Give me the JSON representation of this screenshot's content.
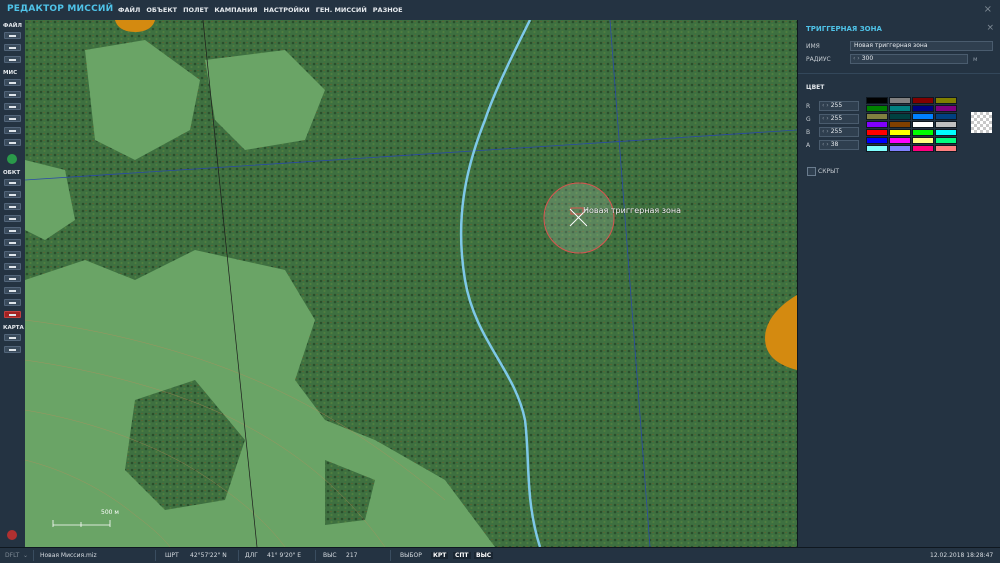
{
  "app": {
    "title": "РЕДАКТОР МИССИЙ",
    "close_glyph": "×"
  },
  "menu": [
    "ФАЙЛ",
    "ОБЪЕКТ",
    "ПОЛЕТ",
    "КАМПАНИЯ",
    "НАСТРОЙКИ",
    "ГЕН. МИССИЙ",
    "РАЗНОЕ"
  ],
  "toolbar": {
    "file": "ФАЙЛ",
    "mission": "МИС",
    "objects": "ОБКТ",
    "map": "КАРТА"
  },
  "map": {
    "zone_label": "Новая триггерная зона",
    "scale_label": "500 м"
  },
  "panel": {
    "title": "ТРИГГЕРНАЯ ЗОНА",
    "close_glyph": "×",
    "name_label": "ИМЯ",
    "name_value": "Новая триггерная зона",
    "radius_label": "РАДИУС",
    "radius_value": "300",
    "radius_unit": "м",
    "color_title": "ЦВЕТ",
    "r_label": "R",
    "r_value": "255",
    "g_label": "G",
    "g_value": "255",
    "b_label": "B",
    "b_value": "255",
    "a_label": "A",
    "a_value": "38",
    "hidden_label": "СКРЫТ",
    "palette": [
      "#000000",
      "#808080",
      "#800000",
      "#808000",
      "#008000",
      "#008080",
      "#000080",
      "#800080",
      "#808040",
      "#004040",
      "#0080ff",
      "#004080",
      "#8000ff",
      "#804000",
      "#ffffff",
      "#c0c0c0",
      "#ff0000",
      "#ffff00",
      "#00ff00",
      "#00ffff",
      "#0000ff",
      "#ff00ff",
      "#ffff80",
      "#00ff80",
      "#80ffff",
      "#8080ff",
      "#ff0080",
      "#ff8080"
    ]
  },
  "status": {
    "profile": "DFLT",
    "file": "Новая Миссия.miz",
    "lat_label": "ШРТ",
    "lat_value": "42°57'22\" N",
    "lon_label": "ДЛГ",
    "lon_value": "41° 9'20\" E",
    "alt_label": "ВЫС",
    "alt_value": "217",
    "select_label": "ВЫБОР",
    "btn_map": "КРТ",
    "btn_sat": "СПТ",
    "btn_alt": "ВЫС",
    "datetime": "12.02.2018 18:28:47"
  },
  "colors": {
    "accent": "#4fc3e8",
    "zone": "#d9534f",
    "map_green": "#5f9a5e",
    "forest": "#3e7040",
    "river": "#7ec8e8"
  }
}
